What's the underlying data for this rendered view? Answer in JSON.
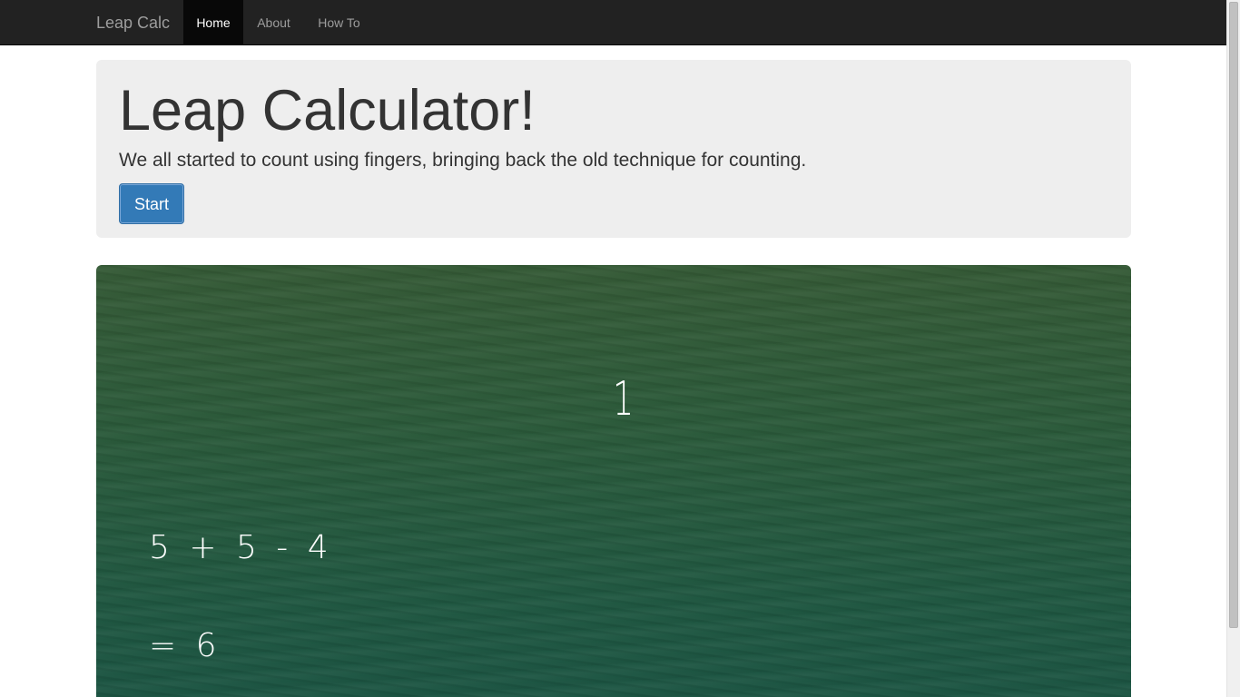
{
  "navbar": {
    "brand": "Leap Calc",
    "items": [
      {
        "label": "Home",
        "active": true
      },
      {
        "label": "About",
        "active": false
      },
      {
        "label": "How To",
        "active": false
      }
    ]
  },
  "jumbotron": {
    "title": "Leap Calculator!",
    "lead": "We all started to count using fingers, bringing back the old technique for counting.",
    "start_label": "Start"
  },
  "chalkboard": {
    "finger_count": "1",
    "expression": "5 + 5 - 4",
    "result": "= 6"
  },
  "colors": {
    "navbar_bg": "#222222",
    "nav_active_bg": "#080808",
    "jumbotron_bg": "#eeeeee",
    "primary_button": "#337ab7",
    "chalkboard_green": "#2b5a3a",
    "chalk_text": "#ffffff"
  }
}
